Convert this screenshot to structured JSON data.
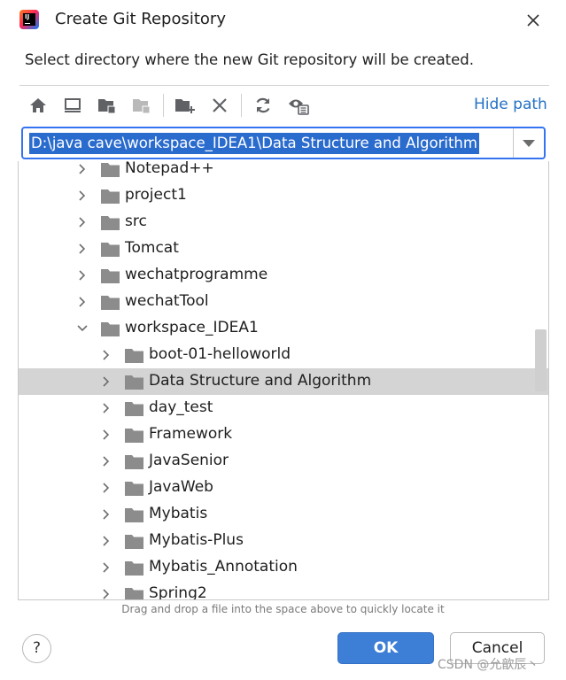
{
  "window": {
    "title": "Create Git Repository",
    "description": "Select directory where the new Git repository will be created."
  },
  "toolbar": {
    "buttons": [
      {
        "name": "home-icon"
      },
      {
        "name": "desktop-icon"
      },
      {
        "name": "project-folder-icon"
      },
      {
        "name": "module-folder-icon",
        "disabled": true
      },
      {
        "name": "new-folder-icon"
      },
      {
        "name": "delete-icon"
      },
      {
        "name": "refresh-icon"
      },
      {
        "name": "show-hidden-icon"
      }
    ],
    "hide_path_label": "Hide path"
  },
  "path_field": {
    "value": "D:\\java cave\\workspace_IDEA1\\Data Structure and Algorithm"
  },
  "tree": {
    "rows": [
      {
        "label": "Notepad++",
        "level": 1,
        "expanded": false,
        "selected": false
      },
      {
        "label": "project1",
        "level": 1,
        "expanded": false,
        "selected": false
      },
      {
        "label": "src",
        "level": 1,
        "expanded": false,
        "selected": false
      },
      {
        "label": "Tomcat",
        "level": 1,
        "expanded": false,
        "selected": false
      },
      {
        "label": "wechatprogramme",
        "level": 1,
        "expanded": false,
        "selected": false
      },
      {
        "label": "wechatTool",
        "level": 1,
        "expanded": false,
        "selected": false
      },
      {
        "label": "workspace_IDEA1",
        "level": 1,
        "expanded": true,
        "selected": false
      },
      {
        "label": "boot-01-helloworld",
        "level": 2,
        "expanded": false,
        "selected": false
      },
      {
        "label": "Data Structure and Algorithm",
        "level": 2,
        "expanded": false,
        "selected": true
      },
      {
        "label": "day_test",
        "level": 2,
        "expanded": false,
        "selected": false
      },
      {
        "label": "Framework",
        "level": 2,
        "expanded": false,
        "selected": false
      },
      {
        "label": "JavaSenior",
        "level": 2,
        "expanded": false,
        "selected": false
      },
      {
        "label": "JavaWeb",
        "level": 2,
        "expanded": false,
        "selected": false
      },
      {
        "label": "Mybatis",
        "level": 2,
        "expanded": false,
        "selected": false
      },
      {
        "label": "Mybatis-Plus",
        "level": 2,
        "expanded": false,
        "selected": false
      },
      {
        "label": "Mybatis_Annotation",
        "level": 2,
        "expanded": false,
        "selected": false
      },
      {
        "label": "Spring2",
        "level": 2,
        "expanded": false,
        "selected": false
      }
    ]
  },
  "hint": "Drag and drop a file into the space above to quickly locate it",
  "buttons": {
    "help_label": "?",
    "ok_label": "OK",
    "cancel_label": "Cancel"
  },
  "watermark": "CSDN @允歆辰丶",
  "colors": {
    "accent": "#3574f0",
    "selection": "#2a6bce",
    "link": "#2470c5",
    "ok_button": "#3d7ed6",
    "row_selected": "#d4d4d4",
    "folder": "#8c8c8c"
  }
}
